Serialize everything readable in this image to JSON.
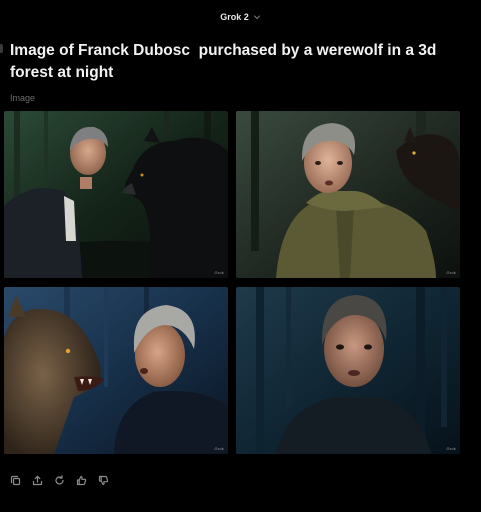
{
  "header": {
    "model_name": "Grok 2",
    "model_icon": "chevron-down-icon"
  },
  "message": {
    "prompt": "Image of Franck Dubosc  purchased by a werewolf in a 3d forest at night",
    "kind_label": "Image"
  },
  "images": [
    {
      "watermark": "Grok",
      "scene": "man facing dark werewolf in night forest"
    },
    {
      "watermark": "Grok",
      "scene": "startled man in olive jacket, werewolf behind"
    },
    {
      "watermark": "Grok",
      "scene": "snarling werewolf face to face with man"
    },
    {
      "watermark": "Grok",
      "scene": "close-up of frightened man in blue night forest"
    }
  ],
  "actions": [
    {
      "icon": "copy-icon"
    },
    {
      "icon": "share-icon"
    },
    {
      "icon": "regenerate-icon"
    },
    {
      "icon": "thumbs-up-icon"
    },
    {
      "icon": "thumbs-down-icon"
    }
  ],
  "colors": {
    "background": "#000000",
    "prompt_text": "#f2f2f2",
    "muted_text": "#6a6a6a",
    "icon": "#8c8c8c"
  }
}
